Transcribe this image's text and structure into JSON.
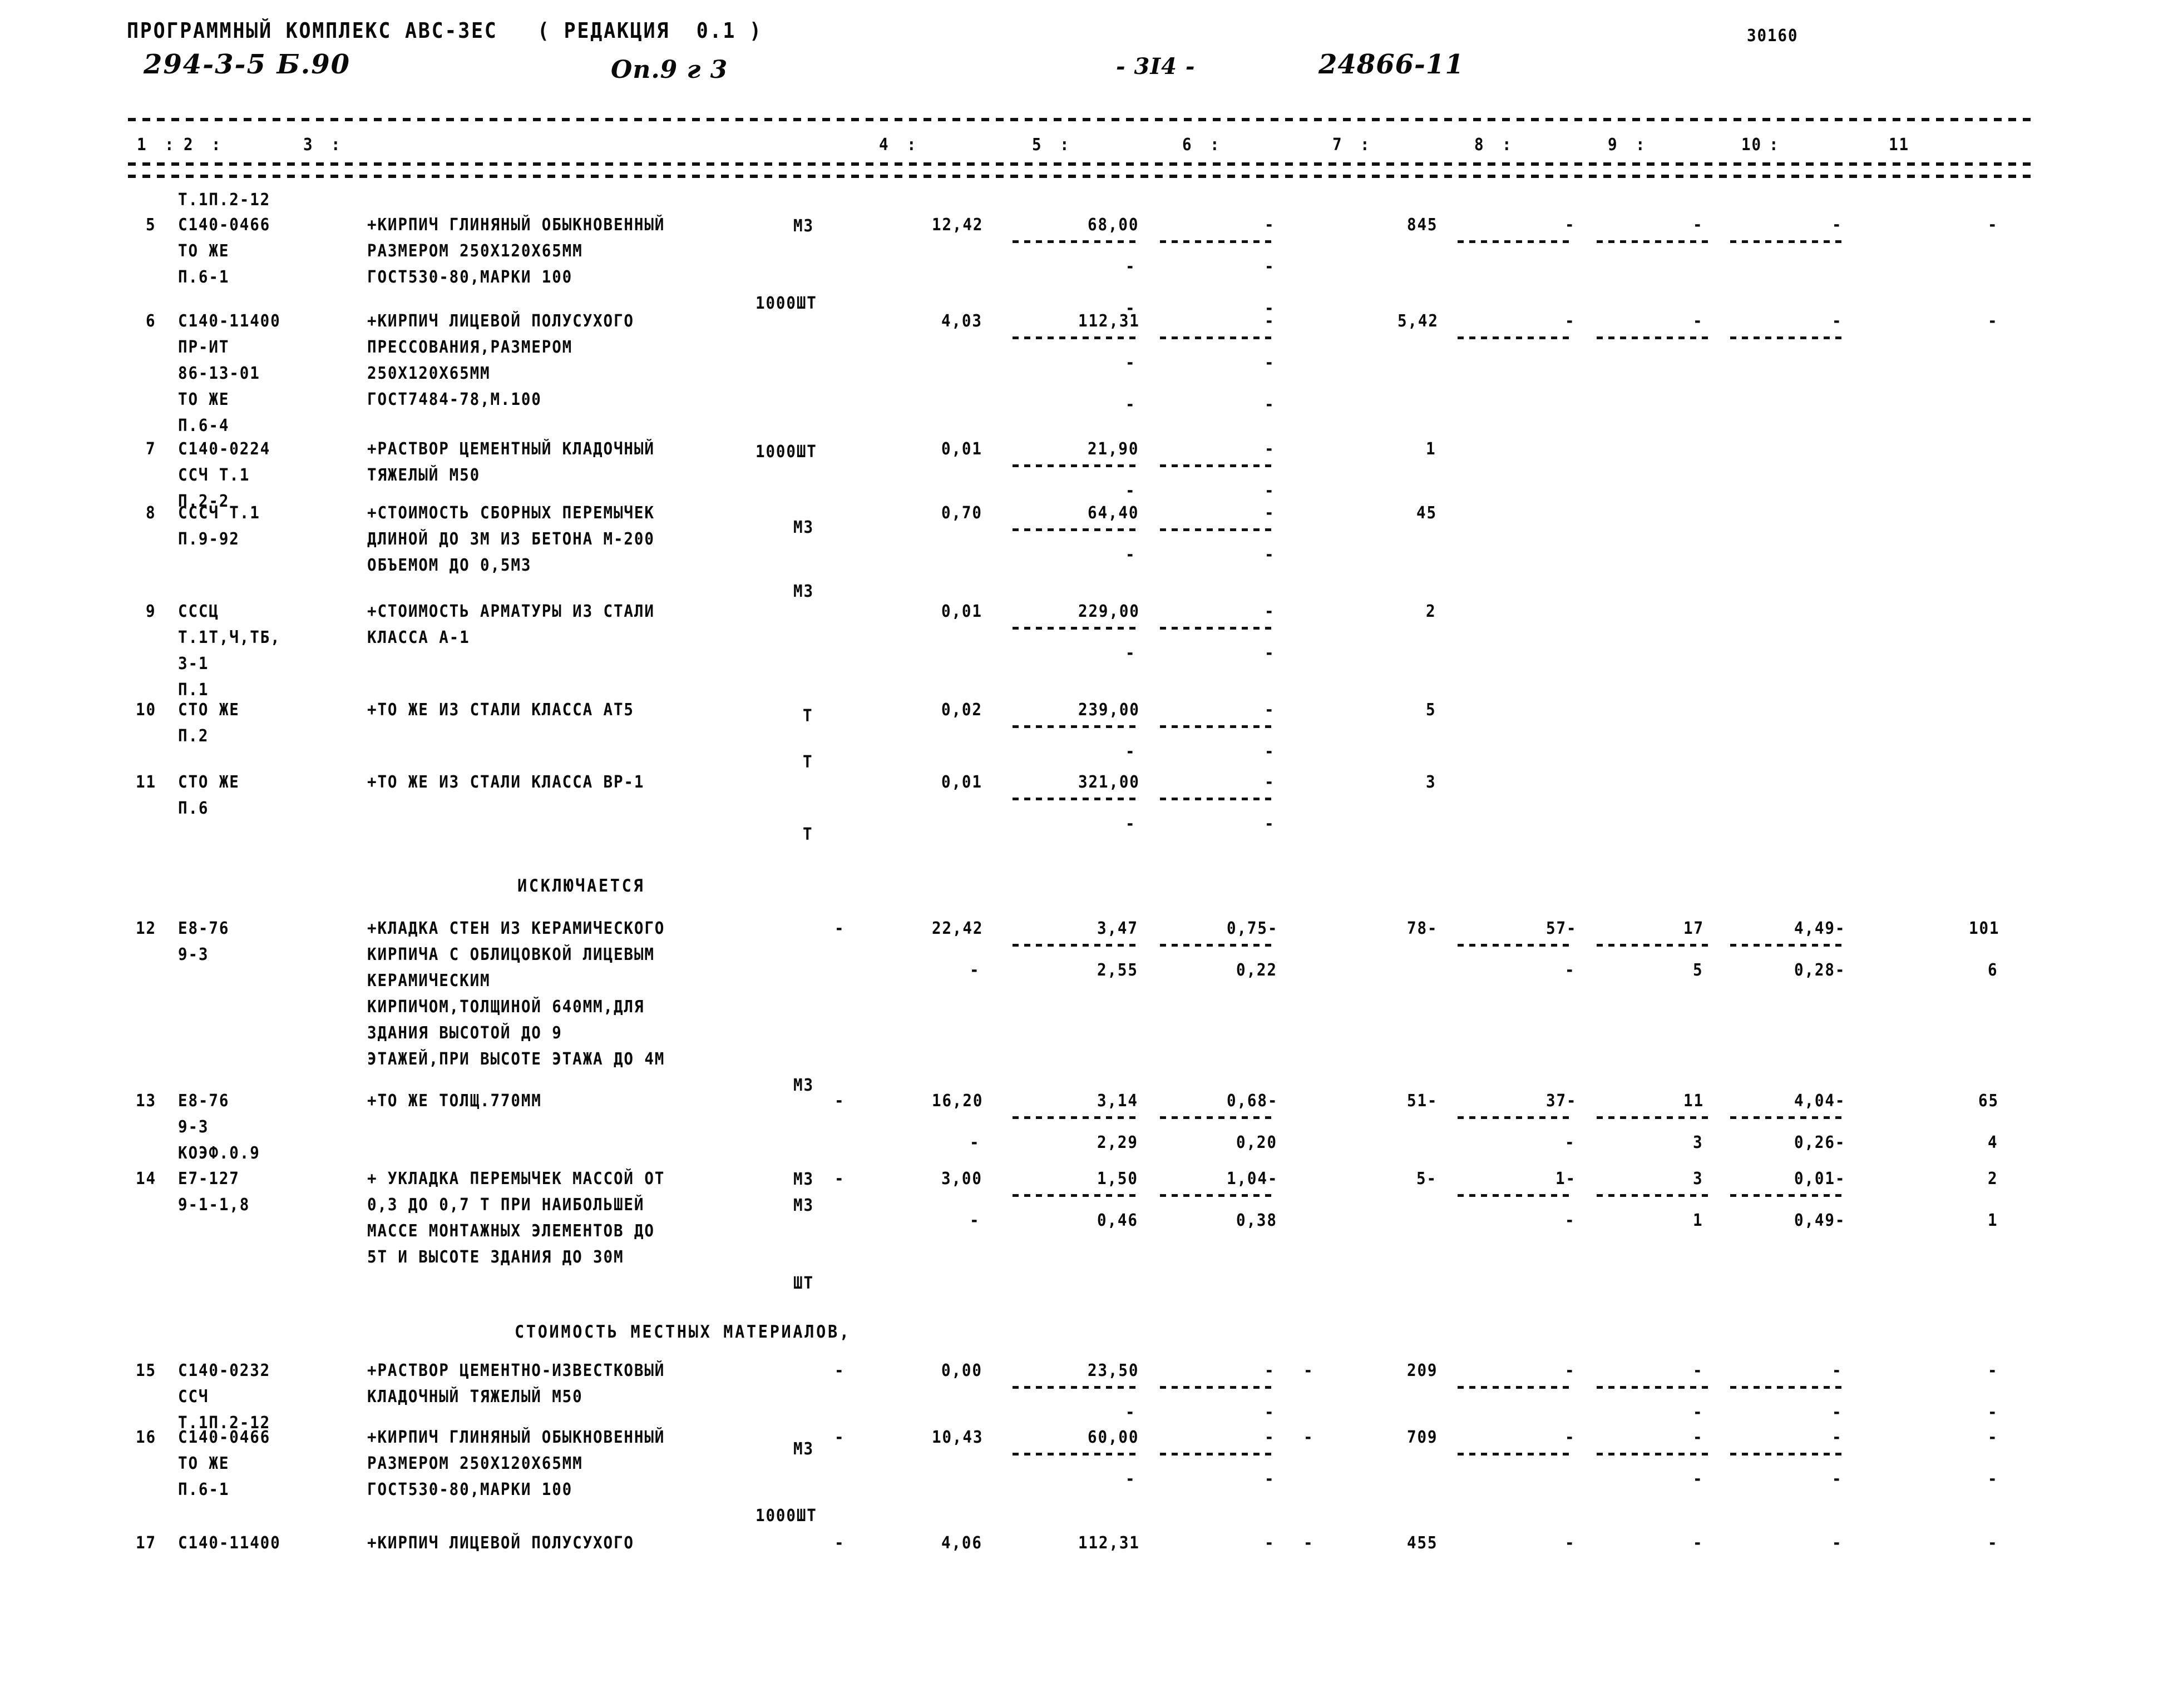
{
  "header": {
    "program_line": "ПРОГРАММНЫЙ КОМПЛЕКС АВС-ЗЕС   ( РЕДАКЦИЯ  0.1 )",
    "doc_code": "294-3-5 Б.90",
    "object": "Оп.9 г 3",
    "page_number": "- 3I4 -",
    "doc_number": "24866-11",
    "top_right_number": "30160"
  },
  "columns": [
    "1",
    "2",
    "3",
    "4",
    "5",
    "6",
    "7",
    "8",
    "9",
    "10",
    "11"
  ],
  "sections": [
    {
      "id": "s1",
      "title": ""
    },
    {
      "id": "s2",
      "title": "ИСКЛЮЧАЕТСЯ"
    },
    {
      "id": "s3",
      "title": "СТОИМОСТЬ МЕСТНЫХ МАТЕРИАЛОВ,"
    }
  ],
  "rows": [
    {
      "no": "",
      "code_lines": [
        "Т.1П.2-12"
      ],
      "desc_lines": [],
      "unit_lines": [
        "М3"
      ],
      "nums": []
    },
    {
      "no": "5",
      "code_lines": [
        "С140-0466",
        "ТО ЖЕ",
        "П.6-1"
      ],
      "desc_lines": [
        "+КИРПИЧ ГЛИНЯНЫЙ ОБЫКНОВЕННЫЙ",
        "РАЗМЕРОМ 250Х120Х65ММ",
        "ГОСТ530-80,МАРКИ 100"
      ],
      "unit_lines": [
        "1000ШТ"
      ],
      "nums": [
        {
          "c4": "12,42",
          "c5": "68,00",
          "c6": "-",
          "c7": "845",
          "c8": "-",
          "c9": "-",
          "c10": "-",
          "c11": "-"
        },
        {
          "c5": "-",
          "c6": "-"
        },
        {
          "c5": "-",
          "c6": "-"
        }
      ]
    },
    {
      "no": "6",
      "code_lines": [
        "С140-11400",
        "ПР-ИТ",
        "86-13-01",
        "ТО ЖЕ",
        "П.6-4"
      ],
      "desc_lines": [
        "+КИРПИЧ ЛИЦЕВОЙ ПОЛУСУХОГО",
        "ПРЕССОВАНИЯ,РАЗМЕРОМ",
        "250Х120Х65ММ",
        "ГОСТ7484-78,М.100"
      ],
      "unit_lines": [
        "1000ШТ"
      ],
      "nums": [
        {
          "c4": "4,03",
          "c5": "112,31",
          "c6": "-",
          "c7": "5,42",
          "c8": "-",
          "c9": "-",
          "c10": "-",
          "c11": "-"
        },
        {
          "c5": "-",
          "c6": "-"
        },
        {
          "c5": "-",
          "c6": "-"
        }
      ]
    },
    {
      "no": "7",
      "code_lines": [
        "С140-0224",
        "ССЧ Т.1",
        "П.2-2"
      ],
      "desc_lines": [
        "+РАСТВОР ЦЕМЕНТНЫЙ КЛАДОЧНЫЙ",
        "ТЯЖЕЛЫЙ М50"
      ],
      "unit_lines": [
        "М3"
      ],
      "nums": [
        {
          "c4": "0,01",
          "c5": "21,90",
          "c6": "-",
          "c7": "1"
        },
        {
          "c5": "-",
          "c6": "-"
        }
      ]
    },
    {
      "no": "8",
      "code_lines": [
        "СССЧ Т.1",
        "П.9-92"
      ],
      "desc_lines": [
        "+СТОИМОСТЬ СБОРНЫХ ПЕРЕМЫЧЕК",
        "ДЛИНОЙ ДО 3М ИЗ БЕТОНА М-200",
        "ОБЪЕМОМ ДО 0,5М3"
      ],
      "unit_lines": [
        "М3"
      ],
      "nums": [
        {
          "c4": "0,70",
          "c5": "64,40",
          "c6": "-",
          "c7": "45"
        },
        {
          "c5": "-",
          "c6": "-"
        }
      ]
    },
    {
      "no": "9",
      "code_lines": [
        "СССЦ",
        "Т.1Т,Ч,ТБ,",
        "3-1",
        "П.1"
      ],
      "desc_lines": [
        "+СТОИМОСТЬ АРМАТУРЫ ИЗ СТАЛИ",
        "КЛАССА А-1"
      ],
      "unit_lines": [
        "Т"
      ],
      "nums": [
        {
          "c4": "0,01",
          "c5": "229,00",
          "c6": "-",
          "c7": "2"
        },
        {
          "c5": "-",
          "c6": "-"
        }
      ]
    },
    {
      "no": "10",
      "code_lines": [
        "СТО ЖЕ",
        "П.2"
      ],
      "desc_lines": [
        "+ТО ЖЕ ИЗ СТАЛИ КЛАССА АТ5"
      ],
      "unit_lines": [
        "Т"
      ],
      "nums": [
        {
          "c4": "0,02",
          "c5": "239,00",
          "c6": "-",
          "c7": "5"
        },
        {
          "c5": "-",
          "c6": "-"
        }
      ]
    },
    {
      "no": "11",
      "code_lines": [
        "СТО ЖЕ",
        "П.6"
      ],
      "desc_lines": [
        "+ТО ЖЕ ИЗ СТАЛИ КЛАССА ВР-1"
      ],
      "unit_lines": [
        "Т"
      ],
      "nums": [
        {
          "c4": "0,01",
          "c5": "321,00",
          "c6": "-",
          "c7": "3"
        },
        {
          "c5": "-",
          "c6": "-"
        }
      ]
    },
    {
      "no": "12",
      "code_lines": [
        "Е8-76",
        "9-3"
      ],
      "desc_lines": [
        "+КЛАДКА СТЕН ИЗ КЕРАМИЧЕСКОГО",
        "КИРПИЧА С ОБЛИЦОВКОЙ ЛИЦЕВЫМ",
        "КЕРАМИЧЕСКИМ",
        "КИРПИЧОМ,ТОЛЩИНОЙ 640ММ,ДЛЯ",
        "ЗДАНИЯ ВЫСОТОЙ ДО 9",
        "ЭТАЖЕЙ,ПРИ ВЫСОТЕ ЭТАЖА ДО 4М"
      ],
      "unit_lines": [
        "М3"
      ],
      "nums": [
        {
          "c3dash": "-",
          "c4": "22,42",
          "c5": "3,47",
          "c6": "0,75-",
          "c7": "78-",
          "c8": "57-",
          "c9": "17",
          "c10": "4,49-",
          "c11": "101"
        },
        {
          "c4": "-",
          "c5": "2,55",
          "c6": "0,22",
          "c8": "-",
          "c9": "5",
          "c10": "0,28-",
          "c11": "6"
        }
      ]
    },
    {
      "no": "13",
      "code_lines": [
        "Е8-76",
        "9-3",
        "КОЭФ.0.9"
      ],
      "desc_lines": [
        "+ТО ЖЕ ТОЛЩ.770ММ"
      ],
      "unit_lines": [
        "М3",
        "М3"
      ],
      "nums": [
        {
          "c3dash": "-",
          "c4": "16,20",
          "c5": "3,14",
          "c6": "0,68-",
          "c7": "51-",
          "c8": "37-",
          "c9": "11",
          "c10": "4,04-",
          "c11": "65"
        },
        {
          "c4": "-",
          "c5": "2,29",
          "c6": "0,20",
          "c8": "-",
          "c9": "3",
          "c10": "0,26-",
          "c11": "4"
        }
      ]
    },
    {
      "no": "14",
      "code_lines": [
        "Е7-127",
        "9-1-1,8"
      ],
      "desc_lines": [
        "+ УКЛАДКА ПЕРЕМЫЧЕК МАССОЙ ОТ",
        "0,3 ДО 0,7 Т ПРИ НАИБОЛЬШЕЙ",
        "МАССЕ МОНТАЖНЫХ ЭЛЕМЕНТОВ ДО",
        "5Т И ВЫСОТЕ ЗДАНИЯ ДО 30М"
      ],
      "unit_lines": [
        "ШТ"
      ],
      "nums": [
        {
          "c3dash": "-",
          "c4": "3,00",
          "c5": "1,50",
          "c6": "1,04-",
          "c7": "5-",
          "c8": "1-",
          "c9": "3",
          "c10": "0,01-",
          "c11": "2"
        },
        {
          "c4": "-",
          "c5": "0,46",
          "c6": "0,38",
          "c8": "-",
          "c9": "1",
          "c10": "0,49-",
          "c11": "1"
        }
      ]
    },
    {
      "no": "15",
      "code_lines": [
        "С140-0232",
        "ССЧ",
        "Т.1П.2-12"
      ],
      "desc_lines": [
        "+РАСТВОР ЦЕМЕНТНО-ИЗВЕСТКОВЫЙ",
        "КЛАДОЧНЫЙ ТЯЖЕЛЫЙ М50"
      ],
      "unit_lines": [
        "М3"
      ],
      "nums": [
        {
          "c3dash": "-",
          "c4": "0,00",
          "c5": "23,50",
          "c6": "-",
          "c6b": "-",
          "c7": "209",
          "c8": "-",
          "c9": "-",
          "c10": "-",
          "c11": "-"
        },
        {
          "c5": "-",
          "c6": "-",
          "c9": "-",
          "c10": "-",
          "c11": "-"
        }
      ]
    },
    {
      "no": "16",
      "code_lines": [
        "С140-0466",
        "ТО ЖЕ",
        "П.6-1"
      ],
      "desc_lines": [
        "+КИРПИЧ ГЛИНЯНЫЙ ОБЫКНОВЕННЫЙ",
        "РАЗМЕРОМ 250Х120Х65ММ",
        "ГОСТ530-80,МАРКИ 100"
      ],
      "unit_lines": [
        "1000ШТ"
      ],
      "nums": [
        {
          "c3dash": "-",
          "c4": "10,43",
          "c5": "60,00",
          "c6": "-",
          "c6b": "-",
          "c7": "709",
          "c8": "-",
          "c9": "-",
          "c10": "-",
          "c11": "-"
        },
        {
          "c5": "-",
          "c6": "-",
          "c9": "-",
          "c10": "-",
          "c11": "-"
        }
      ]
    },
    {
      "no": "17",
      "code_lines": [
        "С140-11400"
      ],
      "desc_lines": [
        "+КИРПИЧ ЛИЦЕВОЙ ПОЛУСУХОГО"
      ],
      "unit_lines": [],
      "nums": [
        {
          "c3dash": "-",
          "c4": "4,06",
          "c5": "112,31",
          "c6": "-",
          "c6b": "-",
          "c7": "455",
          "c8": "-",
          "c9": "-",
          "c10": "-",
          "c11": "-"
        }
      ]
    }
  ],
  "labels": {
    "excluded_heading": "ИСКЛЮЧАЕТСЯ",
    "local_materials_heading": "СТОИМОСТЬ МЕСТНЫХ МАТЕРИАЛОВ,"
  }
}
